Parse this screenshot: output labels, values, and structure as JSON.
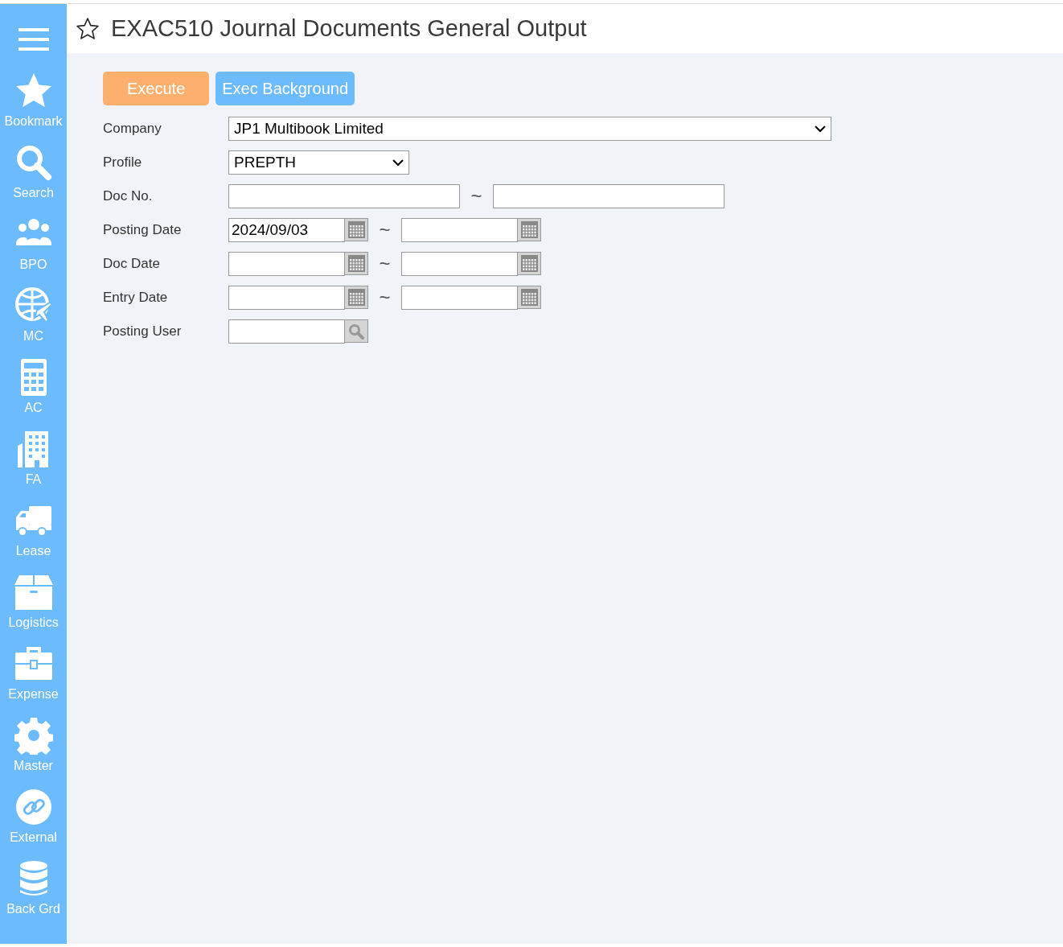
{
  "sidebar": {
    "items": [
      {
        "kind": "star",
        "label": "Bookmark"
      },
      {
        "kind": "search",
        "label": "Search"
      },
      {
        "kind": "people",
        "label": "BPO"
      },
      {
        "kind": "globe",
        "label": "MC"
      },
      {
        "kind": "calculator",
        "label": "AC"
      },
      {
        "kind": "building",
        "label": "FA"
      },
      {
        "kind": "truck",
        "label": "Lease"
      },
      {
        "kind": "box",
        "label": "Logistics"
      },
      {
        "kind": "briefcase",
        "label": "Expense"
      },
      {
        "kind": "gear",
        "label": "Master"
      },
      {
        "kind": "link",
        "label": "External"
      },
      {
        "kind": "database",
        "label": "Back Grd"
      }
    ]
  },
  "title": "EXAC510 Journal Documents General Output",
  "buttons": [
    {
      "kind": "execute",
      "label": "Execute"
    },
    {
      "kind": "background",
      "label": "Exec Background"
    }
  ],
  "form": [
    {
      "kind": "wide_select",
      "label": "Company",
      "value": "JP1 Multibook Limited"
    },
    {
      "kind": "select",
      "label": "Profile",
      "value": "PREPTH"
    },
    {
      "kind": "text_range",
      "label": "Doc No.",
      "separator": "~"
    },
    {
      "kind": "date_range",
      "label": "Posting Date",
      "from": "2024/09/03",
      "separator": "~"
    },
    {
      "kind": "date_range",
      "label": "Doc Date",
      "separator": "~"
    },
    {
      "kind": "date_range",
      "label": "Entry Date",
      "separator": "~"
    },
    {
      "kind": "lookup",
      "label": "Posting User"
    }
  ]
}
